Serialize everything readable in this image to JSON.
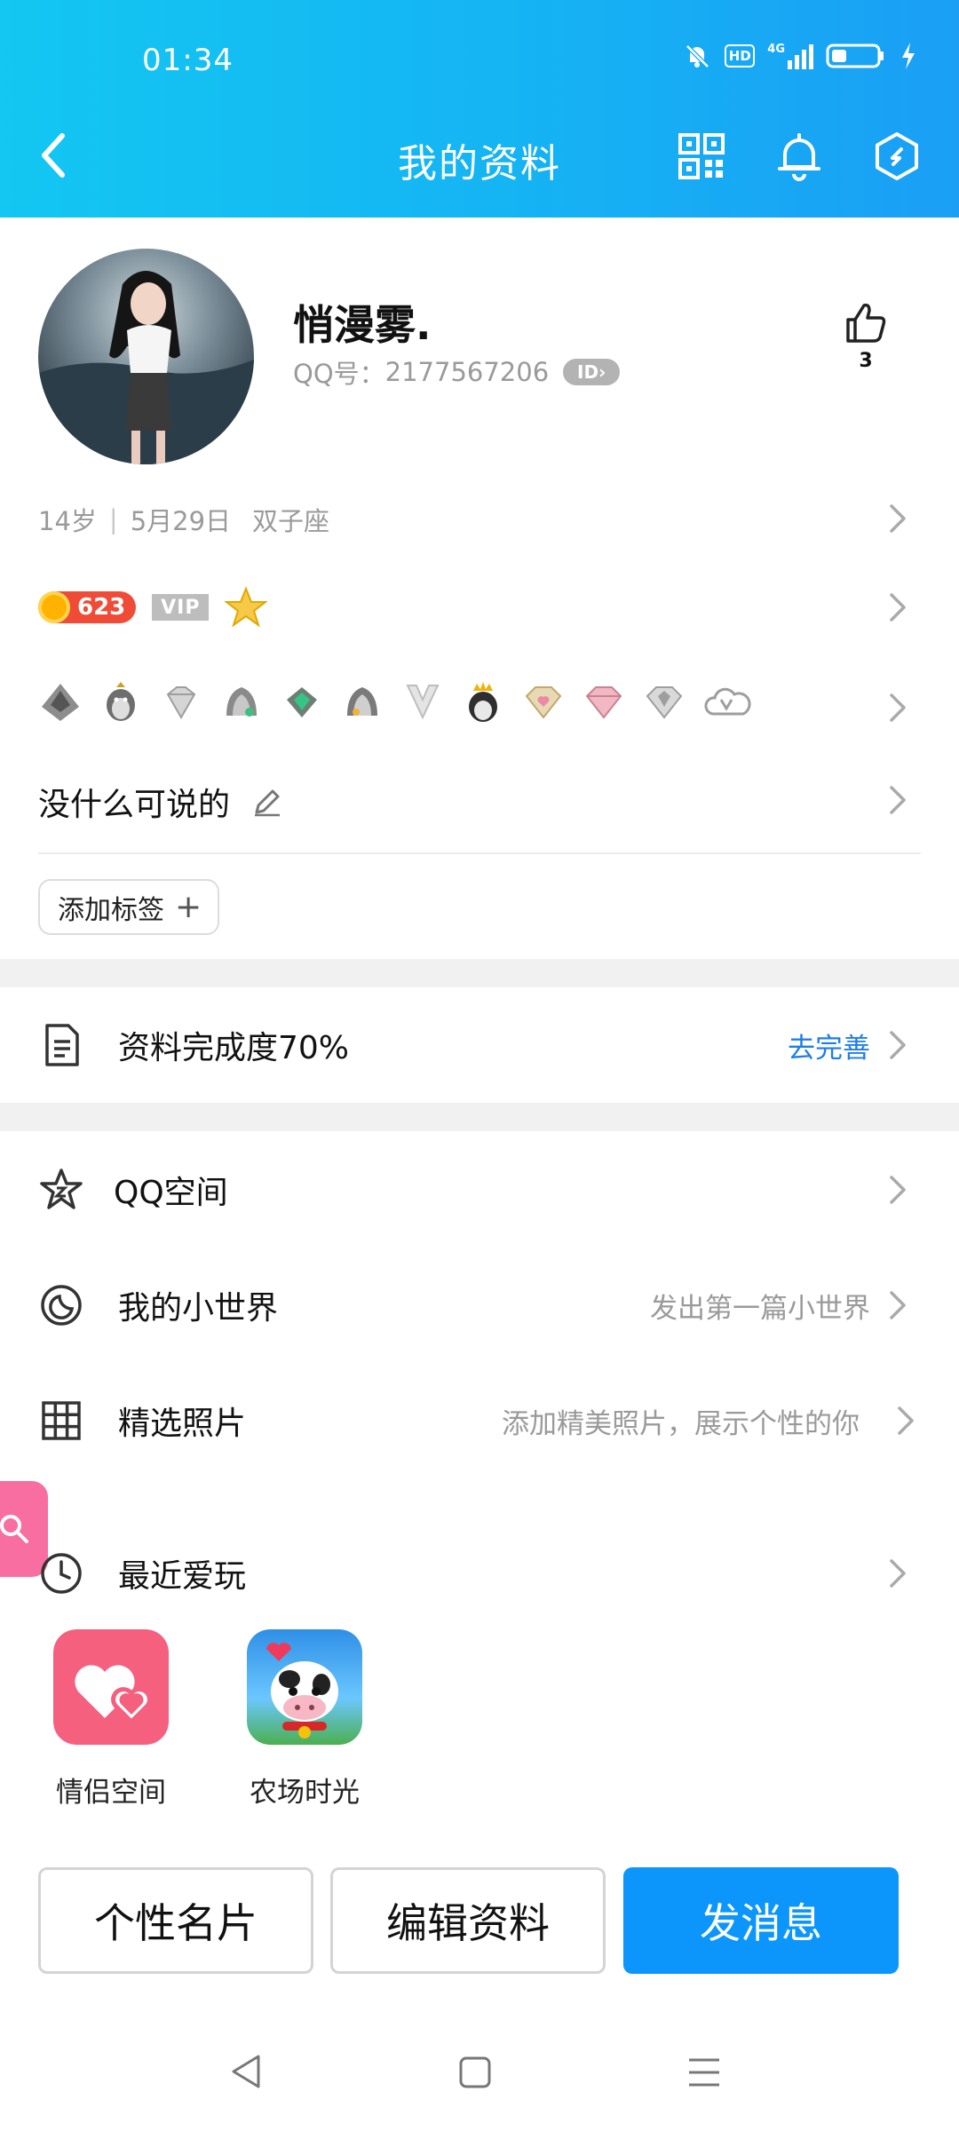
{
  "status_bar": {
    "time": "01:34",
    "hd": "HD",
    "network": "4G"
  },
  "header": {
    "title": "我的资料"
  },
  "profile": {
    "nickname": "悄漫雾.",
    "qq_label": "QQ号：",
    "qq_number": "2177567206",
    "id_badge": "ID",
    "like_count": "3"
  },
  "basic_info": {
    "age": "14岁",
    "birthday": "5月29日",
    "zodiac": "双子座",
    "separator": "|"
  },
  "level": {
    "coin": "623",
    "vip": "VIP"
  },
  "medals": [
    "crown-medal-icon",
    "penguin-medal-icon",
    "diamond-medal-icon",
    "gem-medal-icon",
    "emerald-medal-icon",
    "gem-medal-icon",
    "tuxedo-medal-icon",
    "king-penguin-medal-icon",
    "heart-diamond-medal-icon",
    "pink-diamond-medal-icon",
    "silver-diamond-medal-icon",
    "cloud-v-medal-icon"
  ],
  "signature": "没什么可说的",
  "tag_button": {
    "label": "添加标签",
    "plus": "+"
  },
  "completeness": {
    "label": "资料完成度70%",
    "action": "去完善"
  },
  "menu": {
    "qzone": {
      "label": "QQ空间"
    },
    "world": {
      "label": "我的小世界",
      "hint": "发出第一篇小世界"
    },
    "photos": {
      "label": "精选照片",
      "hint": "添加精美照片，展示个性的你"
    },
    "recent": {
      "label": "最近爱玩"
    }
  },
  "apps": [
    {
      "name": "情侣空间"
    },
    {
      "name": "农场时光"
    }
  ],
  "actions": {
    "card": "个性名片",
    "edit": "编辑资料",
    "message": "发消息"
  },
  "colors": {
    "header_start": "#13c7f2",
    "header_end": "#1a9ff5",
    "primary_button": "#0c96fb",
    "link": "#1e7ee8"
  }
}
